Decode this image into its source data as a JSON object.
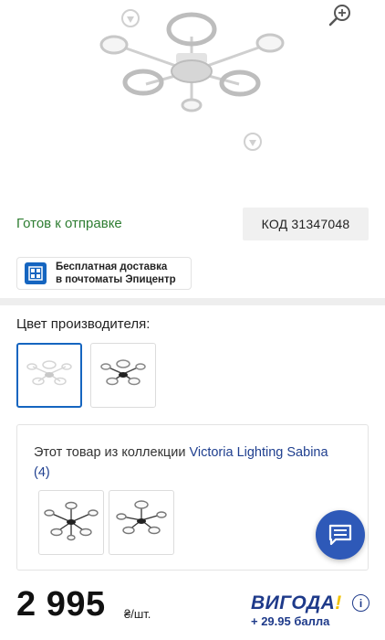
{
  "product": {
    "availability": "Готов к отправке",
    "code_label": "КОД 31347048"
  },
  "delivery": {
    "line1": "Бесплатная доставка",
    "line2": "в почтоматы Эпицентр"
  },
  "color": {
    "label": "Цвет производителя:",
    "options": [
      {
        "name": "white",
        "selected": true
      },
      {
        "name": "black",
        "selected": false
      }
    ]
  },
  "collection": {
    "text": "Этот товар из коллекции ",
    "link": "Victoria Lighting Sabina",
    "count": "(4)"
  },
  "price": {
    "value": "2 995",
    "unit": "₴/шт."
  },
  "vygoda": {
    "brand": "ВИГОДА",
    "mark": "!",
    "bonus": "+ 29.95 балла",
    "info": "i"
  },
  "colors": {
    "accent": "#1565c0",
    "status_green": "#2e7d32",
    "brand_blue": "#1e3a8a",
    "brand_yellow": "#f2c200"
  }
}
